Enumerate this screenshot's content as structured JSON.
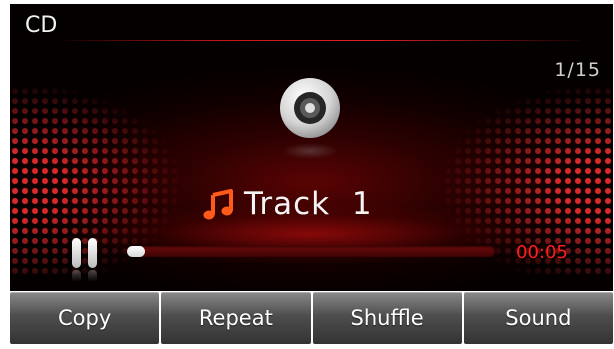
{
  "header": {
    "source_label": "CD",
    "track_counter": "1/15"
  },
  "now_playing": {
    "track_title": "Track  1",
    "elapsed_time": "00:05",
    "progress_fraction": 0.05
  },
  "icons": {
    "disc": "cd-disc-icon",
    "note": "music-note-icon",
    "pause": "pause-icon"
  },
  "softkeys": [
    {
      "label": "Copy"
    },
    {
      "label": "Repeat"
    },
    {
      "label": "Shuffle"
    },
    {
      "label": "Sound"
    }
  ],
  "colors": {
    "accent_red": "#ff1e1e",
    "note_orange": "#ff5a1a",
    "background": "#050000"
  }
}
